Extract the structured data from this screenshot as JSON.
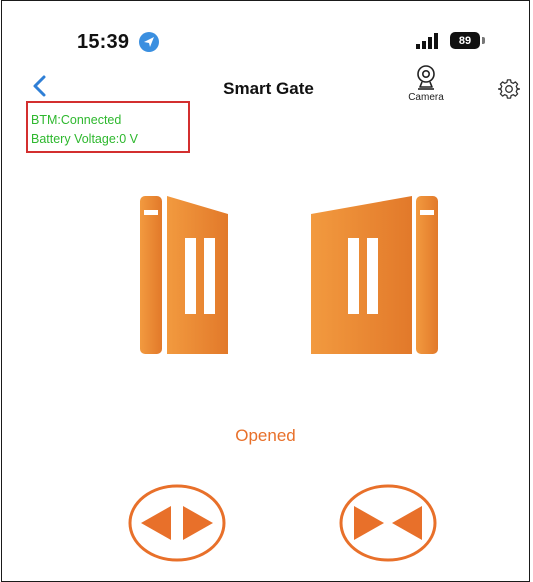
{
  "status_bar": {
    "time": "15:39",
    "battery_level": "89",
    "location_icon": "location-arrow-icon",
    "signal_icon": "signal-bars-icon"
  },
  "nav": {
    "back_icon": "chevron-left-icon",
    "title": "Smart Gate",
    "camera_label": "Camera",
    "camera_icon": "webcam-icon",
    "settings_icon": "gear-icon"
  },
  "status_panel": {
    "connection": "BTM:Connected",
    "battery_voltage": "Battery Voltage:0 V"
  },
  "gate": {
    "state": "Opened",
    "icon": "double-swing-gate-icon"
  },
  "controls": {
    "open_icon": "gate-open-arrows-icon",
    "close_icon": "gate-close-arrows-icon"
  },
  "colors": {
    "accent": "#e8702a",
    "gate_fill": "#e88a2f",
    "status_text": "#2eb82e",
    "status_border": "#d32f2f",
    "back_arrow": "#2f7fd6",
    "location_badge": "#3a8fe0"
  }
}
